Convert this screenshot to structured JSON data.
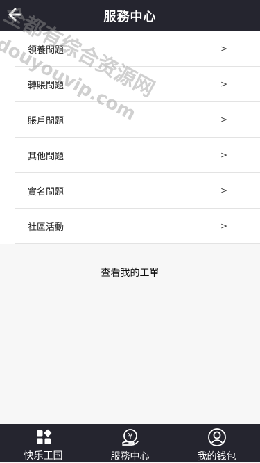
{
  "header": {
    "title": "服務中心"
  },
  "menu": {
    "items": [
      {
        "label": "領養問題",
        "arrow": ">"
      },
      {
        "label": "轉賬問題",
        "arrow": ">"
      },
      {
        "label": "賬戶問題",
        "arrow": ">"
      },
      {
        "label": "其他問題",
        "arrow": ">"
      },
      {
        "label": "實名問題",
        "arrow": ">"
      },
      {
        "label": "社區活動",
        "arrow": ">"
      }
    ]
  },
  "ticket_link": "查看我的工單",
  "tabbar": {
    "tabs": [
      {
        "label": "快乐王国",
        "icon": "apps-grid-icon"
      },
      {
        "label": "服務中心",
        "icon": "service-hand-icon"
      },
      {
        "label": "我的钱包",
        "icon": "user-circle-icon"
      }
    ]
  },
  "watermark": {
    "line1": "全都有综合资源网",
    "line2": "douyouvip.com"
  },
  "colors": {
    "bar": "#25252f",
    "background": "#f7f7f7",
    "divider": "#e3e3e3"
  }
}
